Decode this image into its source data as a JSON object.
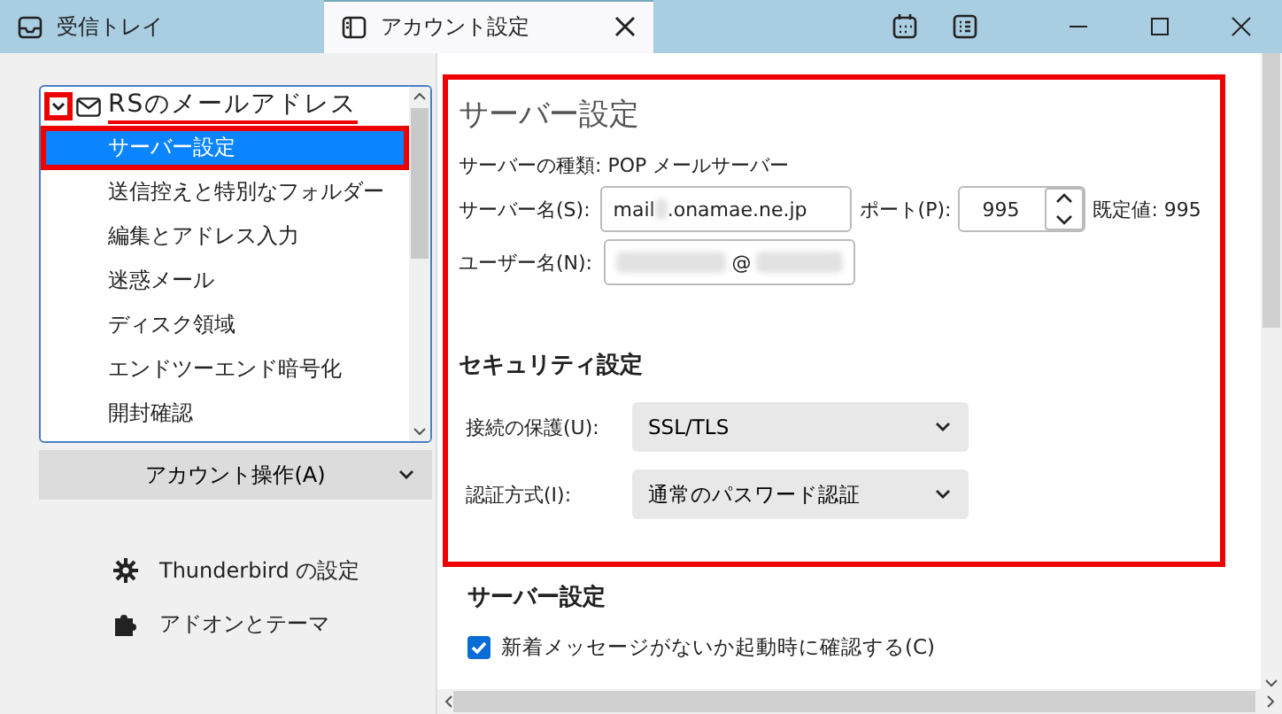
{
  "tabs": [
    {
      "label": "受信トレイ",
      "kind": "inbox",
      "selected": false
    },
    {
      "label": "アカウント設定",
      "kind": "settings",
      "selected": true
    }
  ],
  "account_tree": {
    "account": {
      "name": "RSのメールアドレス",
      "expanded": true,
      "highlighted": true,
      "underlined": true
    },
    "items": [
      {
        "label": "サーバー設定",
        "selected": true,
        "highlighted": true
      },
      {
        "label": "送信控えと特別なフォルダー",
        "selected": false
      },
      {
        "label": "編集とアドレス入力",
        "selected": false
      },
      {
        "label": "迷惑メール",
        "selected": false
      },
      {
        "label": "ディスク領域",
        "selected": false
      },
      {
        "label": "エンドツーエンド暗号化",
        "selected": false
      },
      {
        "label": "開封確認",
        "selected": false
      }
    ]
  },
  "account_actions": {
    "label": "アカウント操作(A)"
  },
  "sidebar_links": [
    {
      "label": "Thunderbird の設定",
      "kind": "gear"
    },
    {
      "label": "アドオンとテーマ",
      "kind": "puzzle"
    }
  ],
  "server_section": {
    "title": "サーバー設定",
    "highlighted": true,
    "server_type": "サーバーの種類: POP メールサーバー",
    "server_name": {
      "label": "サーバー名(S):",
      "value_start": "mail",
      "value_end": ".onamae.ne.jp"
    },
    "port": {
      "label": "ポート(P):",
      "value": "995",
      "default": "既定値: 995"
    },
    "user_name": {
      "label": "ユーザー名(N):",
      "visible_text": "@"
    },
    "security_title": "セキュリティ設定",
    "selects": [
      {
        "label": "接続の保護(U):",
        "value": "SSL/TLS"
      },
      {
        "label": "認証方式(I):",
        "value": "通常のパスワード認証"
      }
    ]
  },
  "server_settings": {
    "title": "サーバー設定",
    "checkboxes": [
      {
        "label": "新着メッセージがないか起動時に確認する(C)",
        "checked": true
      }
    ]
  }
}
